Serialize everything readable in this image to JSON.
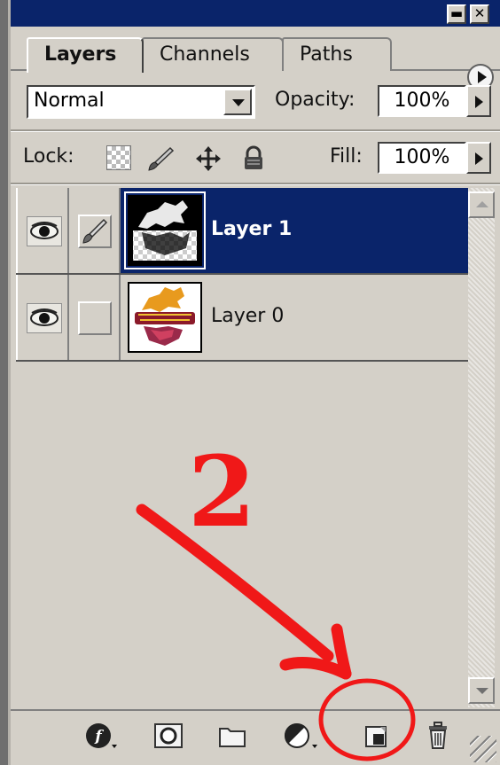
{
  "window": {
    "minimize_glyph": "▬",
    "close_glyph": "✕"
  },
  "tabs": [
    {
      "label": "Layers",
      "active": true
    },
    {
      "label": "Channels",
      "active": false
    },
    {
      "label": "Paths",
      "active": false
    }
  ],
  "blend": {
    "mode": "Normal",
    "opacity_label": "Opacity:",
    "opacity_value": "100%"
  },
  "lock": {
    "label": "Lock:",
    "icons": [
      "lock-transparent-pixels-icon",
      "lock-image-pixels-icon",
      "lock-position-icon",
      "lock-all-icon"
    ],
    "fill_label": "Fill:",
    "fill_value": "100%"
  },
  "layers": [
    {
      "name": "Layer 1",
      "selected": true,
      "visible": true,
      "linked_brush": true
    },
    {
      "name": "Layer 0",
      "selected": false,
      "visible": true,
      "linked_brush": false
    }
  ],
  "bottom_toolbar": [
    "add-layer-style-icon",
    "add-layer-mask-icon",
    "new-group-icon",
    "new-fill-adjustment-layer-icon",
    "create-new-layer-icon",
    "delete-layer-icon"
  ],
  "annotation": {
    "step_number": "2",
    "color": "#f01818",
    "highlighted_control": "create-new-layer-icon"
  },
  "colors": {
    "selection": "#0a246a",
    "panel": "#d4d0c8"
  }
}
